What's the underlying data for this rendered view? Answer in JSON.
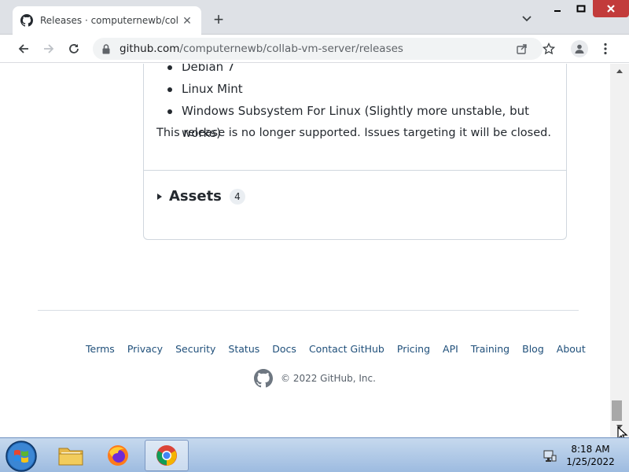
{
  "browser": {
    "tab_title": "Releases · computernewb/collab",
    "new_tab_symbol": "+",
    "url_host": "github.com",
    "url_path": "/computernewb/collab-vm-server/releases"
  },
  "release": {
    "supported_systems": [
      "Debian 7",
      "Linux Mint",
      "Windows Subsystem For Linux (Slightly more unstable, but works)"
    ],
    "support_note": "This release is no longer supported. Issues targeting it will be closed.",
    "assets_label": "Assets",
    "assets_count": "4"
  },
  "footer": {
    "links": [
      "Terms",
      "Privacy",
      "Security",
      "Status",
      "Docs",
      "Contact GitHub",
      "Pricing",
      "API",
      "Training",
      "Blog",
      "About"
    ],
    "copyright": "© 2022 GitHub, Inc."
  },
  "taskbar": {
    "time": "8:18 AM",
    "date": "1/25/2022",
    "apps": [
      "file-explorer",
      "firefox",
      "chrome"
    ]
  }
}
